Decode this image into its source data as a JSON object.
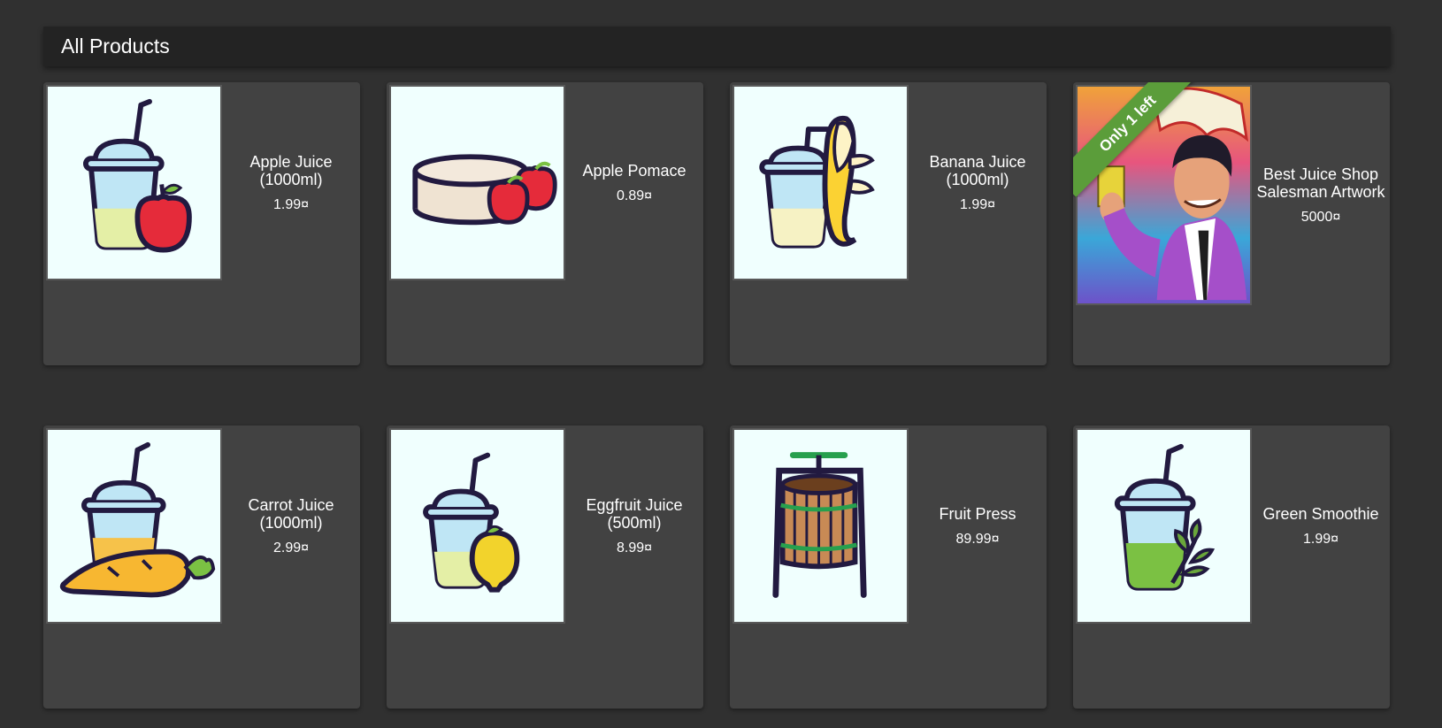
{
  "header": {
    "title": "All Products"
  },
  "products": [
    {
      "name": "Apple Juice (1000ml)",
      "price": "1.99¤"
    },
    {
      "name": "Apple Pomace",
      "price": "0.89¤"
    },
    {
      "name": "Banana Juice (1000ml)",
      "price": "1.99¤"
    },
    {
      "name": "Best Juice Shop Salesman Artwork",
      "price": "5000¤",
      "ribbon": "Only 1 left"
    },
    {
      "name": "Carrot Juice (1000ml)",
      "price": "2.99¤"
    },
    {
      "name": "Eggfruit Juice (500ml)",
      "price": "8.99¤"
    },
    {
      "name": "Fruit Press",
      "price": "89.99¤"
    },
    {
      "name": "Green Smoothie",
      "price": "1.99¤"
    }
  ],
  "colors": {
    "background": "#303030",
    "header": "#232323",
    "card": "#424242",
    "ribbon": "#5b9d3a",
    "image_bg": "#f0fffe"
  },
  "icons": [
    "juice-cup-apple-icon",
    "pomace-apple-icon",
    "juice-cup-banana-icon",
    "salesman-artwork-image",
    "juice-cup-carrot-icon",
    "juice-cup-eggfruit-icon",
    "fruit-press-icon",
    "juice-cup-leaf-icon"
  ]
}
